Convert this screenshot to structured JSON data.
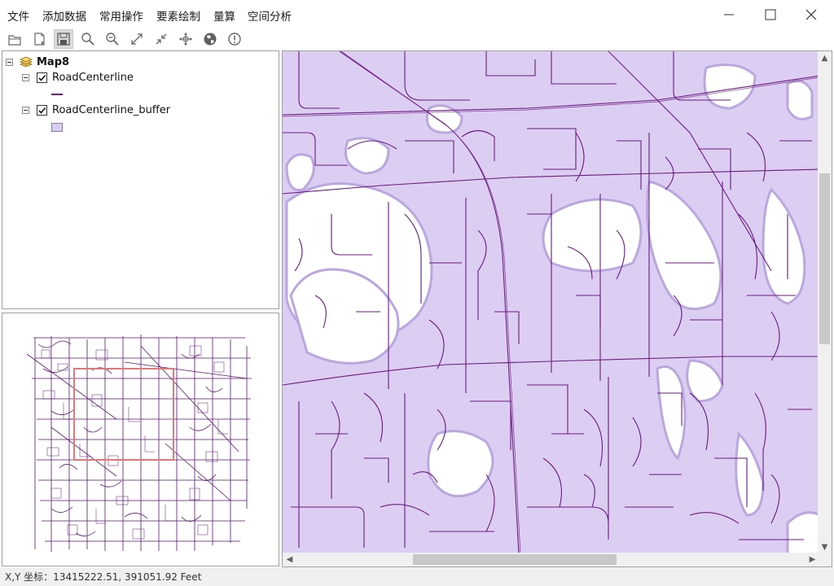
{
  "menu": {
    "items": [
      "文件",
      "添加数据",
      "常用操作",
      "要素绘制",
      "量算",
      "空间分析"
    ]
  },
  "window_controls": {
    "icons": [
      "minimize-icon",
      "maximize-icon",
      "close-icon"
    ]
  },
  "toolbar": {
    "tools": [
      "open-document-icon",
      "new-document-icon",
      "save-icon",
      "zoom-in-icon",
      "zoom-out-icon",
      "full-extent-icon",
      "zoom-to-layer-icon",
      "pan-icon",
      "globe-icon",
      "identify-icon"
    ],
    "active_tool": "save-icon"
  },
  "toc": {
    "map_name": "Map8",
    "layers": [
      {
        "name": "RoadCenterline",
        "checked": true,
        "symbol": "line",
        "color": "#7a1a86"
      },
      {
        "name": "RoadCenterline_buffer",
        "checked": true,
        "symbol": "fill",
        "color": "#d9cdf0"
      }
    ]
  },
  "map": {
    "buffer_fill": "#dccdf3",
    "road_color": "#6a1a80",
    "outline_color": "#b9a7de"
  },
  "status": {
    "coords": "X,Y 坐标：13415222.51, 391051.92  Feet"
  }
}
